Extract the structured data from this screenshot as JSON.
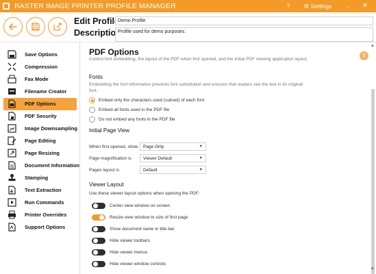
{
  "window": {
    "title": "RASTER IMAGE PRINTER PROFILE MANAGER",
    "help_label": "?",
    "settings_label": "Settings",
    "minimize_label": "–",
    "close_label": "✕"
  },
  "header": {
    "edit_profile_label": "Edit Profile -",
    "description_label": "Description",
    "profile_name": "Demo Profile",
    "profile_description": "Profile used for demo purposes."
  },
  "sidebar": {
    "items": [
      {
        "label": "Save Options",
        "icon": "save-options-icon"
      },
      {
        "label": "Compression",
        "icon": "compression-icon"
      },
      {
        "label": "Fax Mode",
        "icon": "fax-icon"
      },
      {
        "label": "Filename Creator",
        "icon": "filename-icon"
      },
      {
        "label": "PDF Options",
        "icon": "pdf-icon",
        "active": true
      },
      {
        "label": "PDF Security",
        "icon": "pdf-security-icon"
      },
      {
        "label": "Image Downsampling",
        "icon": "downsampling-icon"
      },
      {
        "label": "Page Editing",
        "icon": "page-editing-icon"
      },
      {
        "label": "Page Resizing",
        "icon": "page-resizing-icon"
      },
      {
        "label": "Document Information",
        "icon": "document-info-icon"
      },
      {
        "label": "Stamping",
        "icon": "stamp-icon"
      },
      {
        "label": "Text Extraction",
        "icon": "text-extraction-icon"
      },
      {
        "label": "Run Commands",
        "icon": "run-commands-icon"
      },
      {
        "label": "Printer Overrides",
        "icon": "printer-icon"
      },
      {
        "label": "Support Options",
        "icon": "support-icon"
      }
    ]
  },
  "main": {
    "title": "PDF Options",
    "description": "Control font embedding, the layout of the PDF when first opened, and the initial PDF viewing application layout.",
    "help_icon_label": "?",
    "fonts": {
      "title": "Fonts",
      "description": "Embedding the font information prevents font substitution and ensures that readers see the text in its original font.",
      "options": [
        {
          "label": "Embed only the characters used (subset) of each font",
          "checked": true
        },
        {
          "label": "Embed all fonts used in the PDF file",
          "checked": false
        },
        {
          "label": "Do not embed any fonts in the PDF file",
          "checked": false
        }
      ]
    },
    "initial_page_view": {
      "title": "Initial Page View",
      "rows": [
        {
          "label": "When first opened, show",
          "value": "Page Only"
        },
        {
          "label": "Page magnification is",
          "value": "Viewer Default"
        },
        {
          "label": "Pages layout is",
          "value": "Default"
        }
      ],
      "dropdown_arrow": "▼"
    },
    "viewer_layout": {
      "title": "Viewer Layout",
      "description": "Use these viewer layout options when opening the PDF:",
      "toggles": [
        {
          "label": "Center view window on screen",
          "on": false
        },
        {
          "label": "Resize view window to size of first page",
          "on": true
        },
        {
          "label": "Show document name in title bar",
          "on": false
        },
        {
          "label": "Hide viewer toolbars",
          "on": false
        },
        {
          "label": "Hide viewer menus",
          "on": false
        },
        {
          "label": "Hide viewer window controls",
          "on": false
        }
      ]
    }
  },
  "colors": {
    "accent": "#f39a29",
    "active_item": "#f6a23d",
    "toggle_off": "#2f2f2f"
  }
}
